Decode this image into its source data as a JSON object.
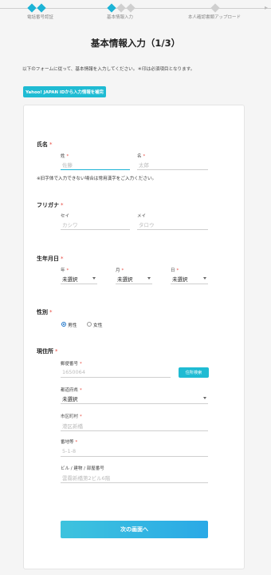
{
  "steps": [
    {
      "label": "電話番号認証",
      "state": "active"
    },
    {
      "label": "基本情報入力",
      "state": "active"
    },
    {
      "label": "本人確認書類アップロード",
      "state": "inactive"
    }
  ],
  "title": "基本情報入力（1/3）",
  "intro": "以下のフォームに従って、基本情報を入力してください。＊印は必須項目となります。",
  "yahoo_button": "Yahoo! JAPAN IDから入力情報を補完",
  "required_mark": "*",
  "name": {
    "title": "氏名",
    "last_label": "姓",
    "last_placeholder": "佐藤",
    "first_label": "名",
    "first_placeholder": "太郎",
    "note": "※旧字体で入力できない場合は常用漢字をご入力ください。"
  },
  "kana": {
    "title": "フリガナ",
    "last_label": "セイ",
    "last_placeholder": "カシワ",
    "first_label": "メイ",
    "first_placeholder": "タロウ"
  },
  "birth": {
    "title": "生年月日",
    "year_label": "年",
    "month_label": "月",
    "day_label": "日",
    "year_value": "未選択",
    "month_value": "未選択",
    "day_value": "未選択"
  },
  "gender": {
    "title": "性別",
    "options": [
      {
        "label": "男性",
        "checked": true
      },
      {
        "label": "女性",
        "checked": false
      }
    ]
  },
  "address": {
    "title": "現住所",
    "postal_label": "郵便番号",
    "postal_placeholder": "1650064",
    "search_button": "住所検索",
    "pref_label": "都道府県",
    "pref_value": "未選択",
    "city_label": "市区町村",
    "city_placeholder": "港区新橋",
    "street_label": "番地等",
    "street_placeholder": "5-1-8",
    "building_label": "ビル / 建物 / 部屋番号",
    "building_placeholder": "雲霧新橋第2ビル6階"
  },
  "next_button": "次の画面へ",
  "colors": {
    "accent": "#1fbbd3",
    "required": "#e8493f",
    "radio": "#1a73c9",
    "background": "#f5f5f5"
  }
}
